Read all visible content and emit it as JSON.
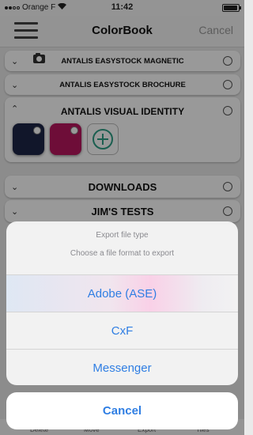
{
  "status": {
    "carrier": "Orange F",
    "time": "11:42"
  },
  "nav": {
    "title": "ColorBook",
    "cancel": "Cancel"
  },
  "library": [
    {
      "title": "ANTALIS EASYSTOCK MAGNETIC"
    },
    {
      "title": "ANTALIS EASYSTOCK BROCHURE"
    },
    {
      "title": "ANTALIS VISUAL IDENTITY",
      "swatch_colors": [
        "#1d2647",
        "#b8175e"
      ]
    },
    {
      "title": "DOWNLOADS"
    },
    {
      "title": "JIM'S TESTS"
    }
  ],
  "action_sheet": {
    "title": "Export file type",
    "message": "Choose a file format to export",
    "options": [
      "Adobe (ASE)",
      "CxF",
      "Messenger"
    ],
    "cancel": "Cancel"
  },
  "tab_bar": [
    "Delete",
    "Move",
    "Export",
    "Tiles"
  ],
  "colors": {
    "accent": "#2f7ee3",
    "add_icon": "#2e9e86"
  }
}
